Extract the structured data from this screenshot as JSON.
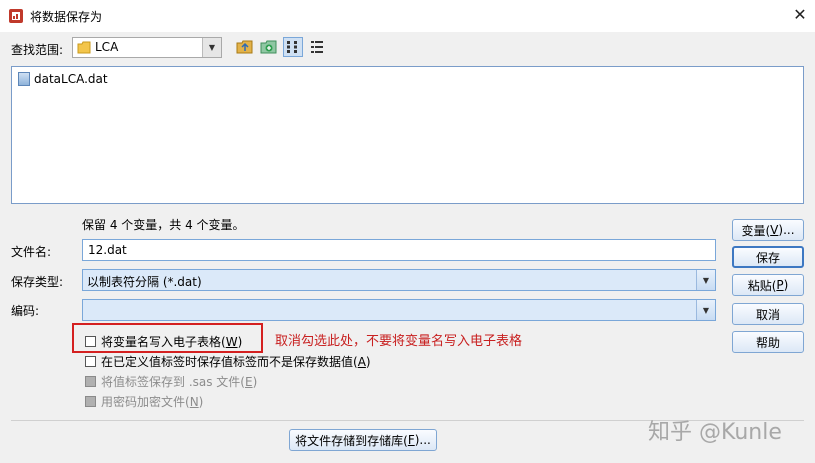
{
  "window": {
    "title": "将数据保存为",
    "close_symbol": "✕"
  },
  "lookin": {
    "label": "查找范围:",
    "value": "LCA"
  },
  "files": [
    {
      "name": "dataLCA.dat"
    }
  ],
  "info_text": "保留 4 个变量，共 4 个变量。",
  "filename": {
    "label": "文件名:",
    "value": "12.dat"
  },
  "filetype": {
    "label": "保存类型:",
    "value": "以制表符分隔 (*.dat)"
  },
  "encoding": {
    "label": "编码:",
    "value": ""
  },
  "options": [
    {
      "pre": "将变量名写入电子表格(",
      "key": "W",
      "post": ")",
      "checked": false,
      "enabled": true
    },
    {
      "pre": "在已定义值标签时保存值标签而不是保存数据值(",
      "key": "A",
      "post": ")",
      "checked": false,
      "enabled": true
    },
    {
      "pre": "将值标签保存到 .sas 文件(",
      "key": "E",
      "post": ")",
      "checked": false,
      "enabled": false
    },
    {
      "pre": "用密码加密文件(",
      "key": "N",
      "post": ")",
      "checked": false,
      "enabled": false
    }
  ],
  "buttons": {
    "variables": {
      "pre": "变量(",
      "key": "V",
      "post": ")..."
    },
    "save": "保存",
    "paste": {
      "pre": "粘贴(",
      "key": "P",
      "post": ")"
    },
    "cancel": "取消",
    "help": "帮助",
    "store": {
      "pre": "将文件存储到存储库(",
      "key": "F",
      "post": ")..."
    }
  },
  "annotation": "取消勾选此处，不要将变量名写入电子表格",
  "watermark": "知乎 @Kunle",
  "colors": {
    "annotation_red": "#d42020",
    "accent_blue": "#3d78c2"
  }
}
